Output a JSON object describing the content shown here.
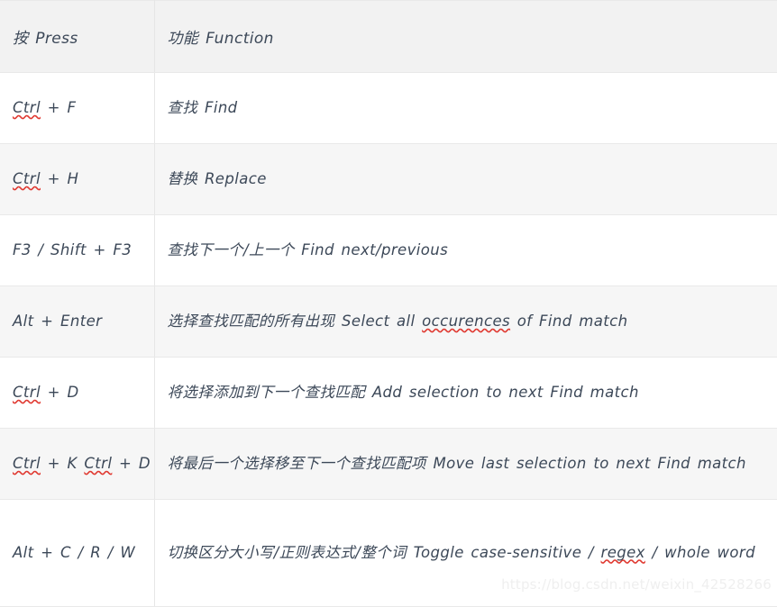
{
  "table": {
    "headers": {
      "press": "按 Press",
      "function": "功能 Function"
    },
    "rows": [
      {
        "press_prefix": "",
        "press_misspelled": "Ctrl",
        "press_suffix": " + F",
        "press_full": "Ctrl + F",
        "func_prefix": "查找 Find",
        "func_misspelled": "",
        "func_suffix": "",
        "func_full": "查找 Find"
      },
      {
        "press_prefix": "",
        "press_misspelled": "Ctrl",
        "press_suffix": " + H",
        "press_full": "Ctrl + H",
        "func_prefix": "替换 Replace",
        "func_misspelled": "",
        "func_suffix": "",
        "func_full": "替换 Replace"
      },
      {
        "press_prefix": "F3 / Shift + F3",
        "press_misspelled": "",
        "press_suffix": "",
        "press_full": "F3 / Shift + F3",
        "func_prefix": "查找下一个/上一个 Find next/previous",
        "func_misspelled": "",
        "func_suffix": "",
        "func_full": "查找下一个/上一个 Find next/previous"
      },
      {
        "press_prefix": "Alt + Enter",
        "press_misspelled": "",
        "press_suffix": "",
        "press_full": "Alt + Enter",
        "func_prefix": "选择查找匹配的所有出现 Select all ",
        "func_misspelled": "occurences",
        "func_suffix": " of Find match",
        "func_full": "选择查找匹配的所有出现 Select all occurences of Find match"
      },
      {
        "press_prefix": "",
        "press_misspelled": "Ctrl",
        "press_suffix": " + D",
        "press_full": "Ctrl + D",
        "func_prefix": "将选择添加到下一个查找匹配 Add selection to next Find match",
        "func_misspelled": "",
        "func_suffix": "",
        "func_full": "将选择添加到下一个查找匹配 Add selection to next Find match"
      },
      {
        "press_prefix": "",
        "press_misspelled": "Ctrl",
        "press_mid": " + K ",
        "press_misspelled2": "Ctrl",
        "press_suffix": " + D",
        "press_full": "Ctrl + K Ctrl + D",
        "func_prefix": "将最后一个选择移至下一个查找匹配项 Move last selection to next Find match",
        "func_misspelled": "",
        "func_suffix": "",
        "func_full": "将最后一个选择移至下一个查找匹配项 Move last selection to next Find match"
      },
      {
        "press_prefix": "Alt + C / R / W",
        "press_misspelled": "",
        "press_suffix": "",
        "press_full": "Alt + C / R / W",
        "func_prefix": "切换区分大小写/正则表达式/整个词 Toggle case-sensitive / ",
        "func_misspelled": "regex",
        "func_suffix": " / whole word",
        "func_full": "切换区分大小写/正则表达式/整个词 Toggle case-sensitive / regex / whole word"
      }
    ]
  },
  "watermark": {
    "text": "https://blog.csdn.net/weixin_42528266"
  },
  "colors": {
    "text": "#3c4858",
    "header_background": "#f2f2f2",
    "row_alt_background": "#f6f6f6",
    "row_background": "#ffffff",
    "border": "#e9e9e9",
    "spellcheck_underline": "#e03a32",
    "watermark": "#efefef"
  }
}
